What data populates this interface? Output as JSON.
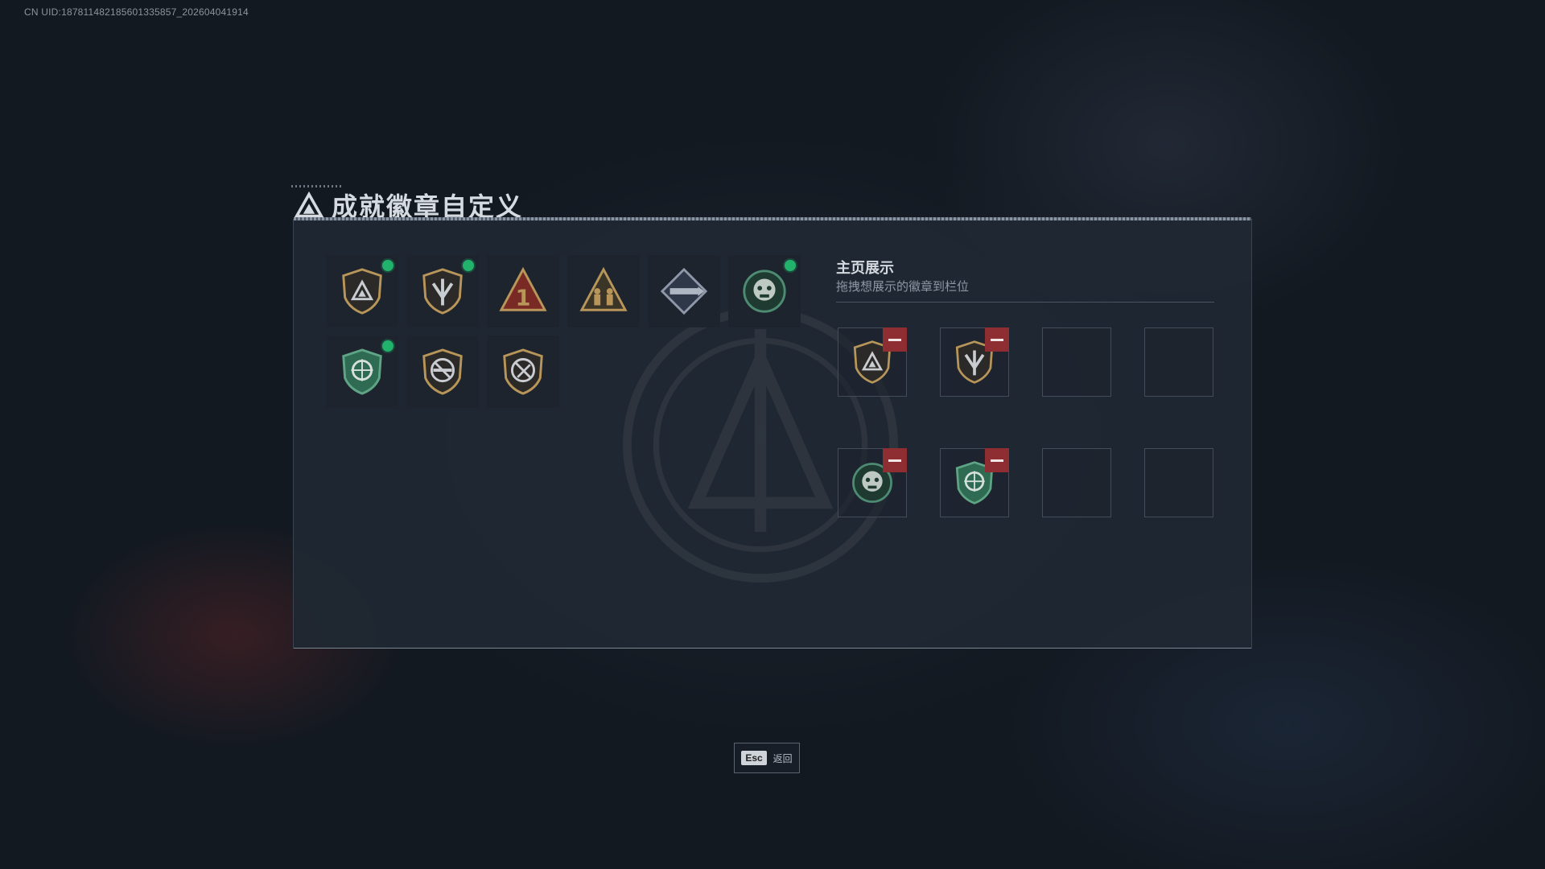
{
  "uid_text": "CN UID:18781148218560133585​7_202604041914",
  "title": "成就徽章自定义",
  "badges": [
    {
      "icon": "shield-triangle-icon",
      "selected": true
    },
    {
      "icon": "shield-wings-icon",
      "selected": true
    },
    {
      "icon": "triangle-one-icon",
      "selected": false
    },
    {
      "icon": "triangle-soldiers-icon",
      "selected": false
    },
    {
      "icon": "diamond-rocket-icon",
      "selected": false
    },
    {
      "icon": "green-beast-icon",
      "selected": true
    },
    {
      "icon": "green-shield-crosshair-icon",
      "selected": true
    },
    {
      "icon": "shield-no-rifle-icon",
      "selected": false
    },
    {
      "icon": "shield-no-knife-icon",
      "selected": false
    }
  ],
  "showcase": {
    "title": "主页展示",
    "subtitle": "拖拽想展示的徽章到栏位",
    "slots": [
      {
        "icon": "shield-triangle-icon"
      },
      {
        "icon": "shield-wings-icon"
      },
      {
        "icon": null
      },
      {
        "icon": null
      },
      {
        "icon": "green-beast-icon"
      },
      {
        "icon": "green-shield-crosshair-icon"
      },
      {
        "icon": null
      },
      {
        "icon": null
      }
    ]
  },
  "footer": {
    "esc_key": "Esc",
    "esc_label": "返回"
  },
  "colors": {
    "selected_dot": "#21b36c",
    "remove_button": "#8e2e32",
    "gold": "#b8965a",
    "green": "#2e6b52"
  }
}
